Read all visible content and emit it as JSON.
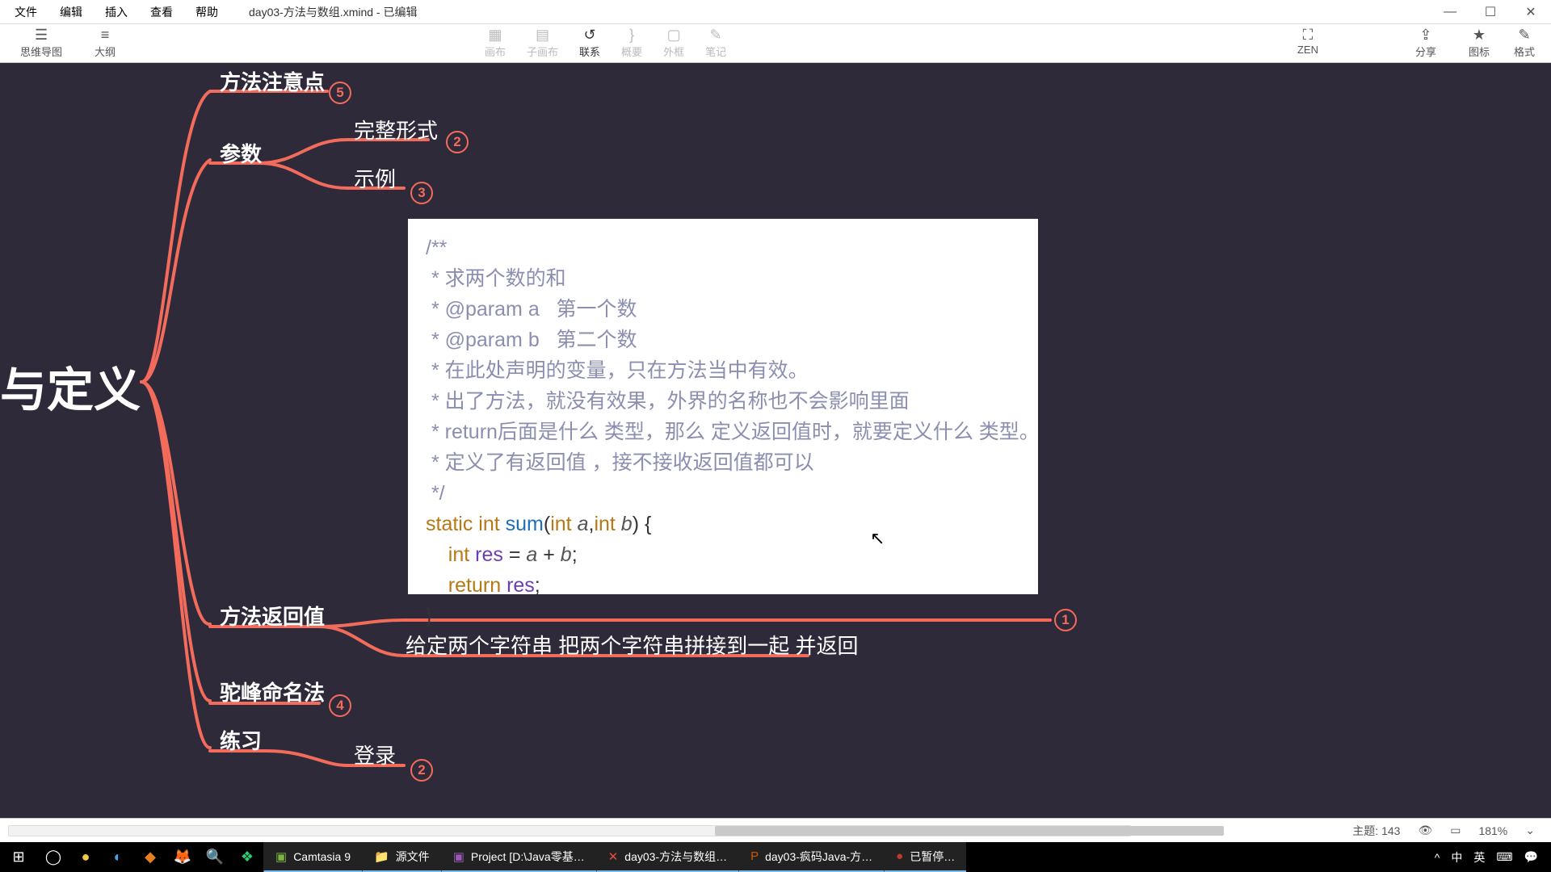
{
  "menu": {
    "file": "文件",
    "edit": "编辑",
    "insert": "插入",
    "view": "查看",
    "help": "帮助"
  },
  "doc_title": "day03-方法与数组.xmind - 已编辑",
  "winbtns": {
    "min": "—",
    "max": "☐",
    "close": "✕"
  },
  "toolbar": {
    "mindmap": "思维导图",
    "outline": "大纲",
    "center": {
      "c1": "画布",
      "c2": "子画布",
      "c3": "联系",
      "c4": "概要",
      "c5": "外框",
      "c6": "笔记"
    },
    "zen": "ZEN",
    "share": "分享",
    "icon": "图标",
    "fmt": "格式"
  },
  "nodes": {
    "root": "与定义",
    "n1": "方法注意点",
    "b1": "5",
    "n2": "参数",
    "n2a": "完整形式",
    "b2a": "2",
    "n2b": "示例",
    "b2b": "3",
    "n3": "方法返回值",
    "b3": "1",
    "n3a": "给定两个字符串 把两个字符串拼接到一起 并返回",
    "n4": "驼峰命名法",
    "b4": "4",
    "n5": "练习",
    "n5a": "登录",
    "b5a": "2"
  },
  "code": {
    "l1": "/**",
    "l2": " * 求两个数的和",
    "l3a": " * ",
    "l3b": "@param",
    "l3c": " a   第一个数",
    "l4a": " * ",
    "l4b": "@param",
    "l4c": " b   第二个数",
    "l5": " * 在此处声明的变量，只在方法当中有效。",
    "l6": " * 出了方法，就没有效果，外界的名称也不会影响里面",
    "l7": " * return后面是什么 类型，那么 定义返回值时，就要定义什么 类型。",
    "l8": " * 定义了有返回值 ，接不接收返回值都可以",
    "l9": " */",
    "l10_static": "static ",
    "l10_int": "int ",
    "l10_fn": "sum",
    "l10_p": "(",
    "l10_t1": "int ",
    "l10_a": "a",
    "l10_c": ",",
    "l10_t2": "int ",
    "l10_b": "b",
    "l10_pb": ") {",
    "l11_pad": "    ",
    "l11_int": "int ",
    "l11_res": "res",
    "l11_eq": " = ",
    "l11_a": "a",
    "l11_pl": " + ",
    "l11_b": "b",
    "l11_sc": ";",
    "l12_pad": "    ",
    "l12_ret": "return ",
    "l12_res": "res",
    "l12_sc": ";",
    "l13": "}"
  },
  "status": {
    "topics_label": "主题:",
    "topics": "143",
    "zoom": "181%",
    "eye": "👁",
    "fit": "▭"
  },
  "taskbar": {
    "camtasia": "Camtasia 9",
    "folder": "源文件",
    "proj": "Project [D:\\Java零基…",
    "xmind": "day03-方法与数组…",
    "ppt": "day03-疯码Java-方…",
    "rec": "已暂停…",
    "tray": {
      "up": "^",
      "ch": "中",
      "en": "英",
      "kb": "⌨",
      "msg": "💬"
    }
  }
}
